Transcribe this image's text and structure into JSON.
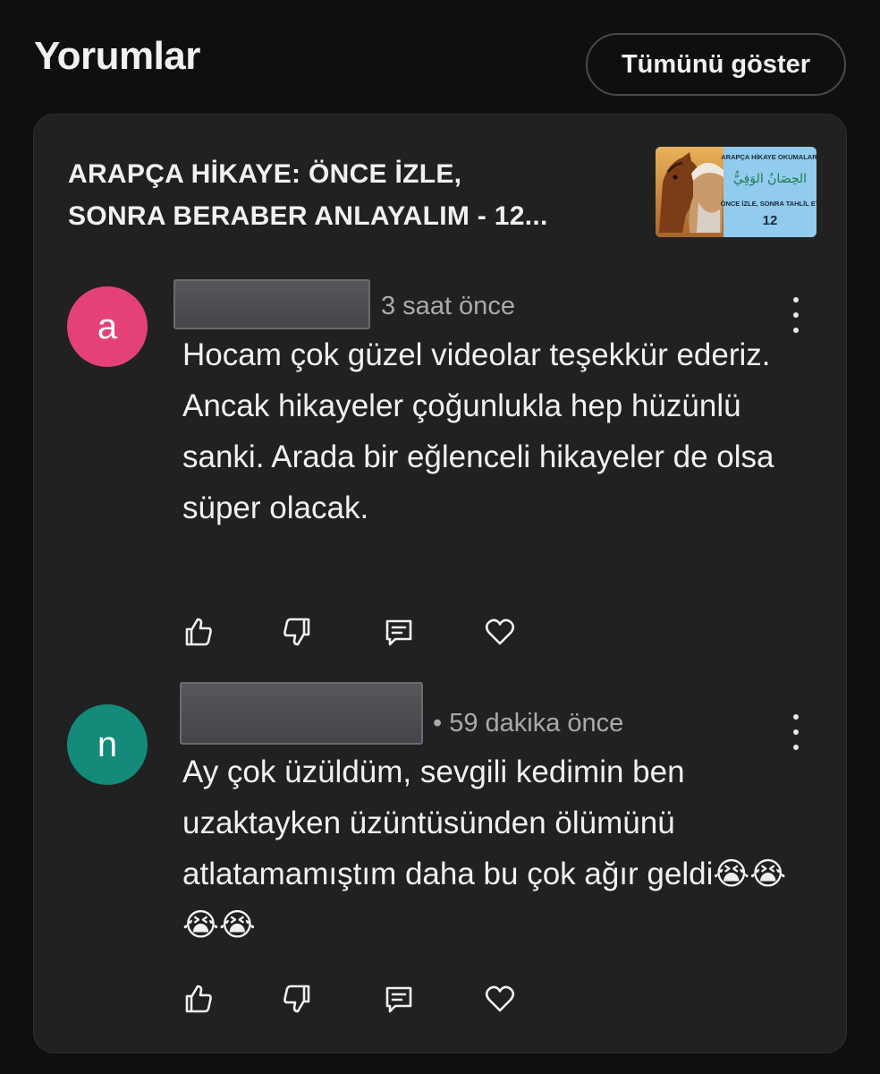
{
  "header": {
    "title": "Yorumlar",
    "show_all_label": "Tümünü göster"
  },
  "video": {
    "title_line1": "ARAPÇA HİKAYE: ÖNCE İZLE,",
    "title_line2": "SONRA BERABER ANLAYALIM - 12...",
    "thumbnail": {
      "top_text": "ARAPÇA HİKAYE OKUMALARI",
      "arabic_text": "الحِصَانُ الوَفِيُّ",
      "subtitle": "ÖNCE İZLE, SONRA TAHLİL ET",
      "number": "12"
    }
  },
  "comments": [
    {
      "avatar_letter": "a",
      "avatar_color": "#e4417a",
      "time": "3 saat önce",
      "text": "Hocam çok güzel videolar teşekkür ederiz. Ancak hikayeler çoğunlukla hep hüzünlü sanki. Arada bir eğlenceli hikayeler de olsa süper olacak."
    },
    {
      "avatar_letter": "n",
      "avatar_color": "#138a7a",
      "time": "• 59 dakika önce",
      "text": "Ay çok üzüldüm, sevgili kedimin ben uzaktayken üzüntüsünden ölümünü atlatamamıştım  daha bu çok ağır geldi😭😭😭😭"
    }
  ],
  "action_icons": [
    "thumbs-up-icon",
    "thumbs-down-icon",
    "reply-icon",
    "heart-icon"
  ],
  "colors": {
    "background": "#0f0f0f",
    "card": "#212121",
    "secondary_text": "#aaaaaa"
  }
}
